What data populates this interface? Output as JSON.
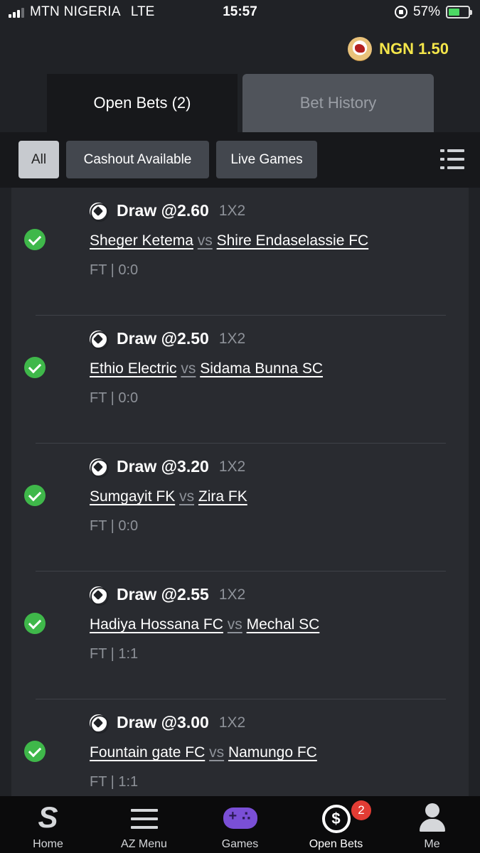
{
  "status_bar": {
    "carrier": "MTN NIGERIA",
    "network": "LTE",
    "time": "15:57",
    "battery": "57%"
  },
  "balance": {
    "amount": "NGN 1.50",
    "color": "#f4e64a"
  },
  "tabs": [
    {
      "label": "Open Bets (2)",
      "active": true
    },
    {
      "label": "Bet History",
      "active": false
    }
  ],
  "filters": [
    {
      "label": "All",
      "selected": true
    },
    {
      "label": "Cashout Available",
      "selected": false
    },
    {
      "label": "Live Games",
      "selected": false
    }
  ],
  "bets": [
    {
      "pick": "Draw @2.60",
      "market": "1X2",
      "home": "Sheger Ketema",
      "vs": "vs",
      "away": "Shire Endaselassie FC",
      "status": "FT | 0:0"
    },
    {
      "pick": "Draw @2.50",
      "market": "1X2",
      "home": "Ethio Electric",
      "vs": "vs",
      "away": "Sidama Bunna SC",
      "status": "FT | 0:0"
    },
    {
      "pick": "Draw @3.20",
      "market": "1X2",
      "home": "Sumgayit FK",
      "vs": "vs",
      "away": "Zira FK",
      "status": "FT | 0:0"
    },
    {
      "pick": "Draw @2.55",
      "market": "1X2",
      "home": "Hadiya Hossana FC",
      "vs": "vs",
      "away": "Mechal SC",
      "status": "FT | 1:1"
    },
    {
      "pick": "Draw @3.00",
      "market": "1X2",
      "home": "Fountain gate FC",
      "vs": "vs",
      "away": "Namungo FC",
      "status": "FT | 1:1"
    }
  ],
  "bottom_nav": [
    {
      "label": "Home",
      "icon": "home-icon"
    },
    {
      "label": "AZ Menu",
      "icon": "menu-icon"
    },
    {
      "label": "Games",
      "icon": "games-icon"
    },
    {
      "label": "Open Bets",
      "icon": "open-bets-icon",
      "badge": "2"
    },
    {
      "label": "Me",
      "icon": "profile-icon"
    }
  ],
  "colors": {
    "background": "#202226",
    "success": "#3fb84a",
    "badge": "#e23c34"
  }
}
